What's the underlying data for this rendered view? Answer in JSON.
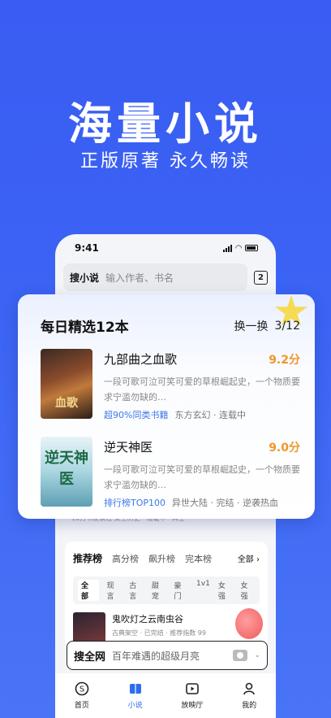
{
  "hero": {
    "title": "海量小说",
    "subtitle": "正版原著 永久畅读"
  },
  "status_bar": {
    "time": "9:41"
  },
  "search": {
    "brand": "搜小说",
    "placeholder": "输入作者、书名",
    "tab_count": "2"
  },
  "daily": {
    "title": "每日精选12本",
    "switch_label": "换一换",
    "pager": "3/12",
    "books": [
      {
        "title": "九部曲之血歌",
        "score": "9.2分",
        "desc": "一段可歌可泣可笑可爱的草根崛起史，一个物质要求宁滥勿缺的…",
        "highlight": "超90%同类书籍",
        "tags": "东方玄幻 · 连载中",
        "cover_text": "血歌"
      },
      {
        "title": "逆天神医",
        "score": "9.0分",
        "desc": "一段可歌可泣可笑可爱的草根崛起史，一个物质要求宁滥勿缺的…",
        "highlight": "排行榜TOP100",
        "tags": "异世大陆 · 完结 · 逆袭热血",
        "cover_text": "逆天神医"
      }
    ]
  },
  "peek_text": "10万书友读过      架空历史 · 连载中 · 具士",
  "ranking": {
    "tabs": [
      "推荐榜",
      "高分榜",
      "飙升榜",
      "完本榜"
    ],
    "all_label": "全部 ›",
    "filters": [
      "全部",
      "现言",
      "古言",
      "甜宠",
      "豪门",
      "1v1",
      "女强",
      "女强"
    ],
    "item": {
      "title": "鬼吹灯之云南虫谷",
      "meta": "古典架空 · 已完结 · 推荐指数 99"
    }
  },
  "global_search": {
    "brand": "搜全网",
    "placeholder": "百年难遇的超级月亮"
  },
  "nav": [
    {
      "label": "首页",
      "icon": "home-s-icon"
    },
    {
      "label": "小说",
      "icon": "book-icon"
    },
    {
      "label": "放映厅",
      "icon": "play-icon"
    },
    {
      "label": "我的",
      "icon": "user-icon"
    }
  ],
  "colors": {
    "accent": "#2e6bf0",
    "score": "#f0962a",
    "highlight": "#3b78e6",
    "background": "#3b63f4"
  }
}
